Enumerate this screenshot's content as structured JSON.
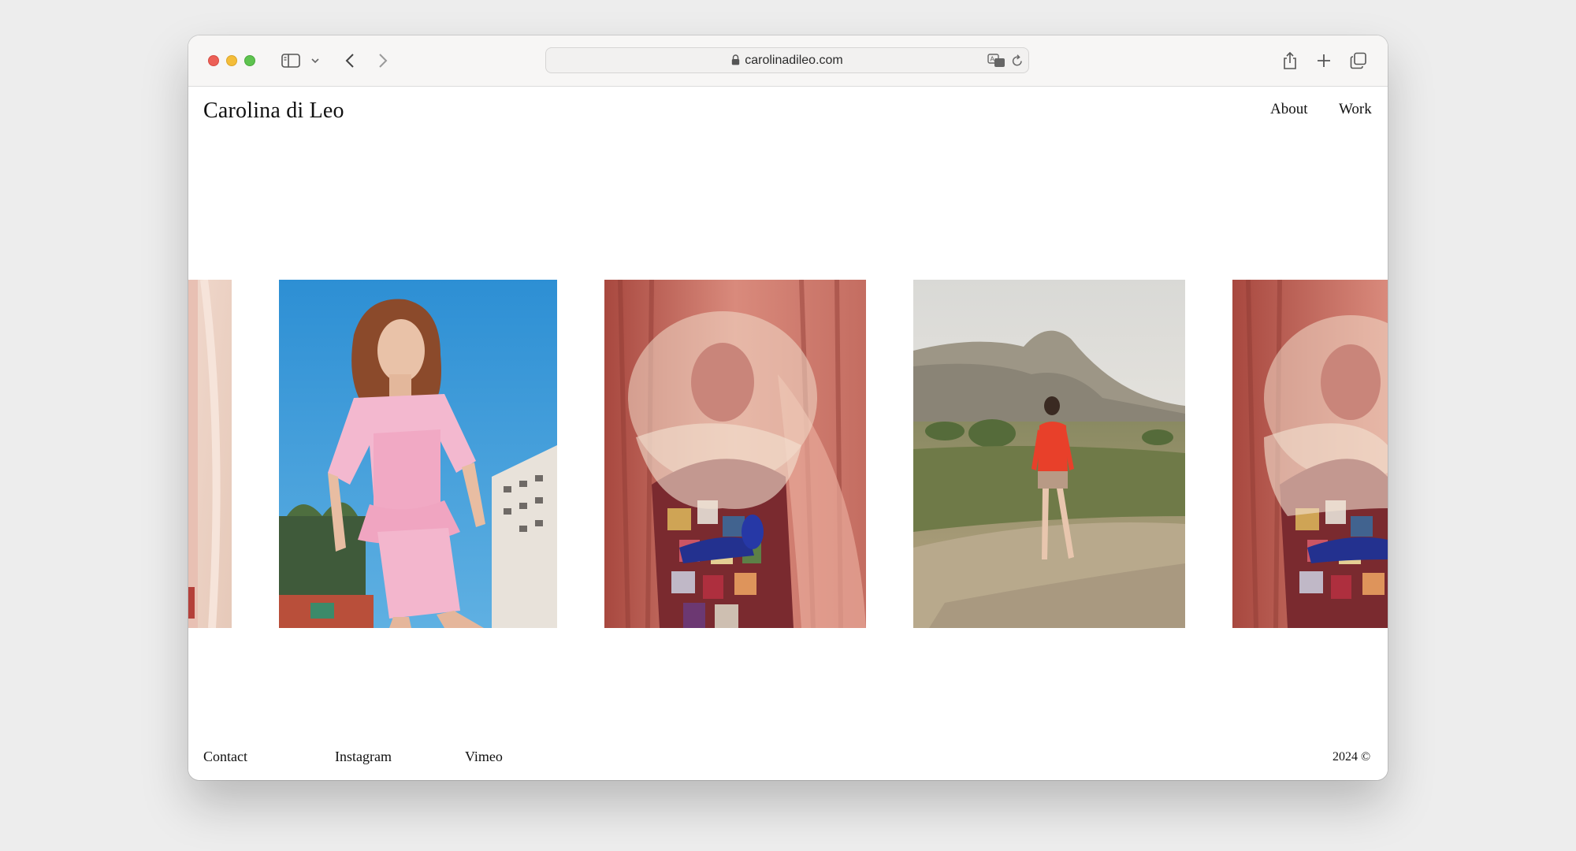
{
  "browser": {
    "url": "carolinadileo.com"
  },
  "site": {
    "title": "Carolina di Leo",
    "nav": {
      "about": "About",
      "work": "Work"
    }
  },
  "gallery": {
    "images": [
      {
        "subject": "partial pink and cream fashion photograph, left edge"
      },
      {
        "subject": "model with red wavy hair in pink peplum dress against blue sky and palm trees"
      },
      {
        "subject": "figure in sculptural tulle and sequined patchwork coat with blue gloves before pink curtains"
      },
      {
        "subject": "model in red sweater and shorts standing on dirt path in field below mountain"
      },
      {
        "subject": "partial repeat of tulle and patchwork coat figure before pink curtains"
      }
    ]
  },
  "footer": {
    "contact": "Contact",
    "instagram": "Instagram",
    "vimeo": "Vimeo",
    "copyright": "2024 ©"
  },
  "icons": {
    "sidebar": "sidebar-toggle-icon",
    "share": "share-icon",
    "new_tab": "plus-icon",
    "tabs": "tab-overview-icon"
  }
}
